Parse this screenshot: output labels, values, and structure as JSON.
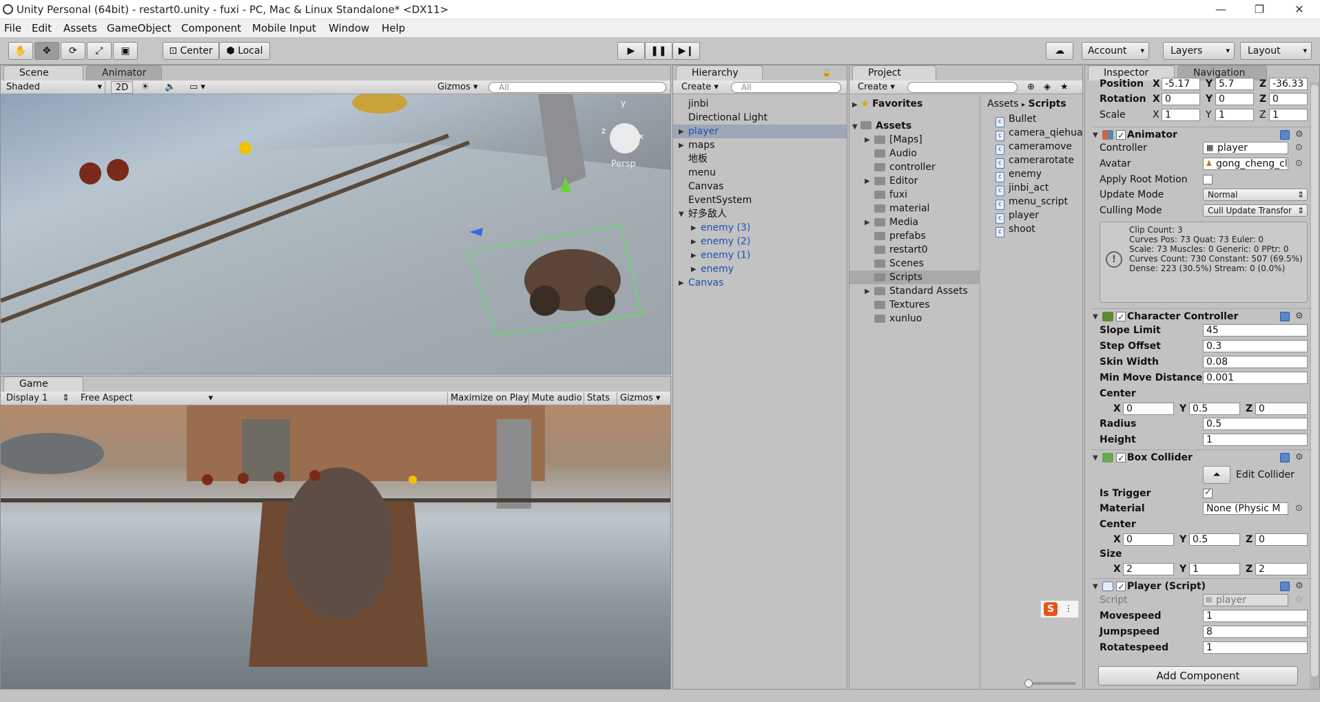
{
  "window": {
    "title": "Unity Personal (64bit) - restart0.unity - fuxi - PC, Mac & Linux Standalone* <DX11>",
    "minimize": "—",
    "maximize": "❐",
    "close": "✕"
  },
  "menubar": [
    "File",
    "Edit",
    "Assets",
    "GameObject",
    "Component",
    "Mobile Input",
    "Window",
    "Help"
  ],
  "toolbar": {
    "pivot": "Center",
    "space": "Local",
    "account": "Account",
    "layers": "Layers",
    "layout": "Layout"
  },
  "scene": {
    "tab_scene": "Scene",
    "tab_animator": "Animator",
    "shading": "Shaded",
    "mode_2d": "2D",
    "gizmos": "Gizmos",
    "search_placeholder": "All",
    "persp": "Persp",
    "axis_y": "y",
    "axis_z": "z",
    "axis_x": "x"
  },
  "game": {
    "tab": "Game",
    "display": "Display 1",
    "aspect": "Free Aspect",
    "maximize": "Maximize on Play",
    "mute": "Mute audio",
    "stats": "Stats",
    "gizmos": "Gizmos"
  },
  "hierarchy": {
    "tab": "Hierarchy",
    "create": "Create",
    "search_placeholder": "All",
    "items": [
      {
        "label": "jinbi",
        "indent": 0,
        "arrow": false,
        "blue": false,
        "selected": false
      },
      {
        "label": "Directional Light",
        "indent": 0,
        "arrow": false,
        "blue": false,
        "selected": false
      },
      {
        "label": "player",
        "indent": 0,
        "arrow": true,
        "blue": true,
        "selected": true
      },
      {
        "label": "maps",
        "indent": 0,
        "arrow": true,
        "blue": false,
        "selected": false
      },
      {
        "label": "地板",
        "indent": 0,
        "arrow": false,
        "blue": false,
        "selected": false
      },
      {
        "label": "menu",
        "indent": 0,
        "arrow": false,
        "blue": false,
        "selected": false
      },
      {
        "label": "Canvas",
        "indent": 0,
        "arrow": false,
        "blue": false,
        "selected": false
      },
      {
        "label": "EventSystem",
        "indent": 0,
        "arrow": false,
        "blue": false,
        "selected": false
      },
      {
        "label": "好多敌人",
        "indent": 0,
        "arrow": true,
        "open": true,
        "blue": false,
        "selected": false
      },
      {
        "label": "enemy (3)",
        "indent": 1,
        "arrow": true,
        "blue": true,
        "selected": false
      },
      {
        "label": "enemy (2)",
        "indent": 1,
        "arrow": true,
        "blue": true,
        "selected": false
      },
      {
        "label": "enemy (1)",
        "indent": 1,
        "arrow": true,
        "blue": true,
        "selected": false
      },
      {
        "label": "enemy",
        "indent": 1,
        "arrow": true,
        "blue": true,
        "selected": false
      },
      {
        "label": "Canvas",
        "indent": 0,
        "arrow": true,
        "blue": true,
        "selected": false
      }
    ]
  },
  "project": {
    "tab": "Project",
    "create": "Create",
    "favorites": "Favorites",
    "assets": "Assets",
    "folders": [
      {
        "label": "[Maps]",
        "arrow": true
      },
      {
        "label": "Audio",
        "arrow": false
      },
      {
        "label": "controller",
        "arrow": false
      },
      {
        "label": "Editor",
        "arrow": true
      },
      {
        "label": "fuxi",
        "arrow": false
      },
      {
        "label": "material",
        "arrow": false
      },
      {
        "label": "Media",
        "arrow": true
      },
      {
        "label": "prefabs",
        "arrow": false
      },
      {
        "label": "restart0",
        "arrow": false
      },
      {
        "label": "Scenes",
        "arrow": false
      },
      {
        "label": "Scripts",
        "arrow": false,
        "selected": true
      },
      {
        "label": "Standard Assets",
        "arrow": true
      },
      {
        "label": "Textures",
        "arrow": false
      },
      {
        "label": "xunluo",
        "arrow": false
      }
    ],
    "breadcrumb_root": "Assets",
    "breadcrumb_sep": "▸",
    "breadcrumb_leaf": "Scripts",
    "files": [
      "Bullet",
      "camera_qiehua",
      "cameramove",
      "camerarotate",
      "enemy",
      "jinbi_act",
      "menu_script",
      "player",
      "shoot"
    ]
  },
  "inspector": {
    "tab": "Inspector",
    "tab_nav": "Navigation",
    "transform": {
      "position_label": "Position",
      "px": "-5.17",
      "py": "5.7",
      "pz": "-36.33",
      "rotation_label": "Rotation",
      "rx": "0",
      "ry": "0",
      "rz": "0",
      "scale_label": "Scale",
      "sx": "1",
      "sy": "1",
      "sz": "1"
    },
    "axis": {
      "x": "X",
      "y": "Y",
      "z": "Z"
    },
    "animator": {
      "title": "Animator",
      "controller_label": "Controller",
      "controller": "player",
      "avatar_label": "Avatar",
      "avatar": "gong_cheng_cl",
      "root_motion_label": "Apply Root Motion",
      "update_label": "Update Mode",
      "update": "Normal",
      "culling_label": "Culling Mode",
      "culling": "Cull Update Transfor",
      "info": "Clip Count: 3\nCurves Pos: 73 Quat: 73 Euler: 0\nScale: 73 Muscles: 0 Generic: 0 PPtr: 0\nCurves Count: 730 Constant: 507 (69.5%) Dense: 223 (30.5%) Stream: 0 (0.0%)"
    },
    "character_controller": {
      "title": "Character Controller",
      "slope_label": "Slope Limit",
      "slope": "45",
      "step_label": "Step Offset",
      "step": "0.3",
      "skin_label": "Skin Width",
      "skin": "0.08",
      "minmove_label": "Min Move Distance",
      "minmove": "0.001",
      "center_label": "Center",
      "cx": "0",
      "cy": "0.5",
      "cz": "0",
      "radius_label": "Radius",
      "radius": "0.5",
      "height_label": "Height",
      "height": "1"
    },
    "box_collider": {
      "title": "Box Collider",
      "edit": "Edit Collider",
      "trigger_label": "Is Trigger",
      "material_label": "Material",
      "material": "None (Physic M",
      "center_label": "Center",
      "cx": "0",
      "cy": "0.5",
      "cz": "0",
      "size_label": "Size",
      "sx": "2",
      "sy": "1",
      "sz": "2"
    },
    "player_script": {
      "title": "Player (Script)",
      "script_label": "Script",
      "script": "player",
      "movespeed_label": "Movespeed",
      "movespeed": "1",
      "jumpspeed_label": "Jumpspeed",
      "jumpspeed": "8",
      "rotatespeed_label": "Rotatespeed",
      "rotatespeed": "1"
    },
    "add_component": "Add Component"
  },
  "ime": {
    "label": "S"
  },
  "colors": {
    "selection": "#9fa6b5",
    "link": "#1e4fb3"
  }
}
